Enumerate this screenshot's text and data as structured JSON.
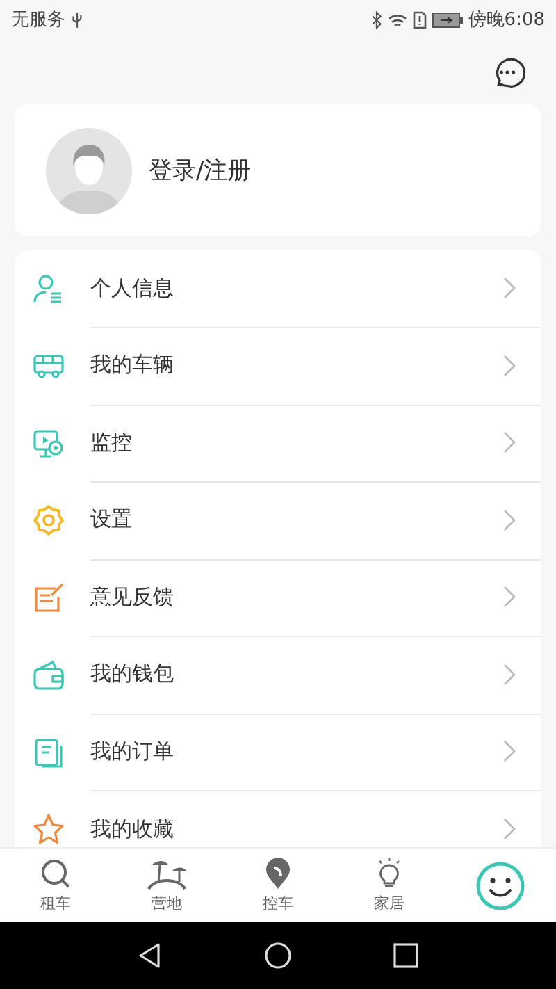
{
  "status_bar": {
    "carrier": "无服务",
    "time": "傍晚6:08"
  },
  "profile": {
    "login_label": "登录/注册"
  },
  "menu": [
    {
      "label": "个人信息",
      "kind": "person",
      "color": "#3cc6b4"
    },
    {
      "label": "我的车辆",
      "kind": "vehicle",
      "color": "#3cc6b4"
    },
    {
      "label": "监控",
      "kind": "monitor",
      "color": "#3cc6b4"
    },
    {
      "label": "设置",
      "kind": "gear",
      "color": "#f6b723"
    },
    {
      "label": "意见反馈",
      "kind": "feedback",
      "color": "#f08a3c"
    },
    {
      "label": "我的钱包",
      "kind": "wallet",
      "color": "#3cc6b4"
    },
    {
      "label": "我的订单",
      "kind": "orders",
      "color": "#3cc6b4"
    },
    {
      "label": "我的收藏",
      "kind": "star",
      "color": "#f08a3c"
    }
  ],
  "tabs": [
    {
      "label": "租车",
      "kind": "search",
      "selected": false
    },
    {
      "label": "营地",
      "kind": "camp",
      "selected": false
    },
    {
      "label": "控车",
      "kind": "pin",
      "selected": false
    },
    {
      "label": "家居",
      "kind": "bulb",
      "selected": false
    },
    {
      "kind": "smile",
      "selected": true
    }
  ]
}
